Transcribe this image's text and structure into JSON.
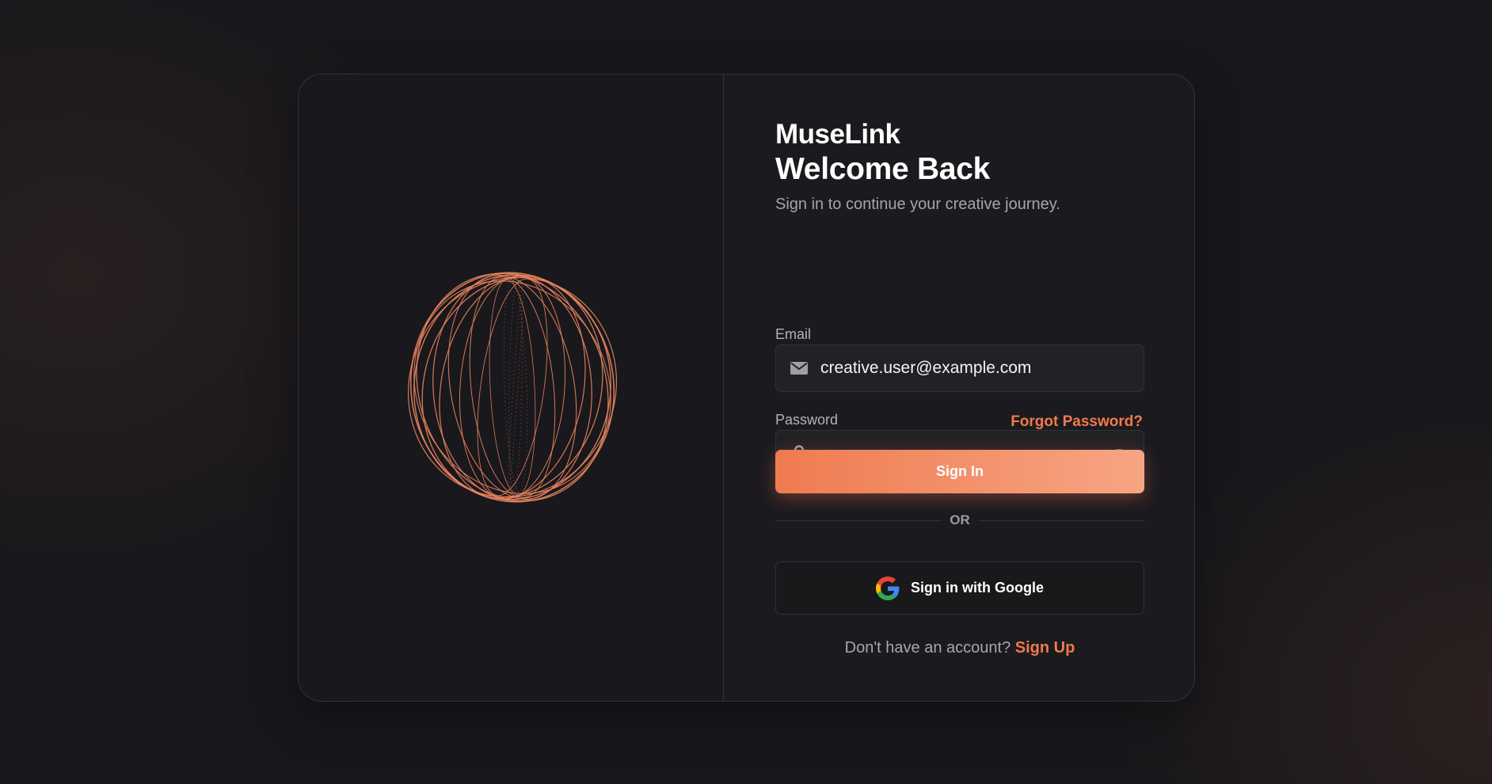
{
  "brand": "MuseLink",
  "heading": "Welcome Back",
  "subtitle": "Sign in to continue your creative journey.",
  "email": {
    "label": "Email",
    "value": "creative.user@example.com",
    "icon": "envelope-icon"
  },
  "password": {
    "label": "Password",
    "value": "•••••••••••",
    "icon": "lock-icon",
    "toggle_icon": "eye-icon"
  },
  "forgot_password": "Forgot Password?",
  "sign_in_button": "Sign In",
  "divider_text": "OR",
  "google_button": {
    "label": "Sign in with Google",
    "icon": "google-g-icon"
  },
  "signup": {
    "prompt": "Don't have an account?",
    "link": "Sign Up"
  },
  "illustration": {
    "icon": "wireframe-orb-illustration",
    "color": "#e8845e"
  },
  "colors": {
    "accent": "#f07a4d",
    "accent_light": "#f7a584",
    "background": "#18171b",
    "card": "#1b1a1e"
  }
}
